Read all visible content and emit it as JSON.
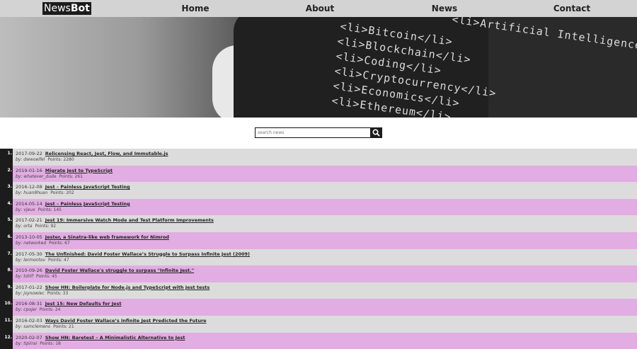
{
  "nav": {
    "logo_plain": "News",
    "logo_bold": "Bot",
    "links": [
      "Home",
      "About",
      "News",
      "Contact"
    ]
  },
  "hero": {
    "code_lines": [
      "<li>Bitcoin</li>",
      "<li>Blockchain</li>",
      "<li>Coding</li>",
      "<li>Cryptocurrency</li>",
      "<li>Economics</li>",
      "<li>Ethereum</li>",
      "<li>Artificial Intelligence</li>"
    ]
  },
  "search": {
    "placeholder": "search news",
    "icon": "search-icon"
  },
  "stories": [
    {
      "num": "1.",
      "date": "2017-09-22",
      "title": "Relicensing React, Jest, Flow, and Immutable.js",
      "author": "by: dwwoelfel",
      "points": "Points: 2280"
    },
    {
      "num": "2.",
      "date": "2019-01-16",
      "title": "Migrate Jest to TypeScript",
      "author": "by: whatever_dude",
      "points": "Points: 261"
    },
    {
      "num": "3.",
      "date": "2016-12-08",
      "title": "Jest – Painless JavaScript Testing",
      "author": "by: huan9huan",
      "points": "Points: 202"
    },
    {
      "num": "4.",
      "date": "2014-05-14",
      "title": "Jest – Painless JavaScript Testing",
      "author": "by: vjeux",
      "points": "Points: 145"
    },
    {
      "num": "5.",
      "date": "2017-02-21",
      "title": "Jest 19: Immersive Watch Mode and Test Platform Improvements",
      "author": "by: orta",
      "points": "Points: 92"
    },
    {
      "num": "6.",
      "date": "2013-10-05",
      "title": "Jester, a Sinatra-like web framework for Nimrod",
      "author": "by: networked",
      "points": "Points: 67"
    },
    {
      "num": "7.",
      "date": "2017-05-30",
      "title": "The Unfinished: David Foster Wallace’s Struggle to Surpass Infinite Jest (2009)",
      "author": "by: lermontov",
      "points": "Points: 47"
    },
    {
      "num": "8.",
      "date": "2010-09-26",
      "title": "David Foster Wallace's struggle to surpass \"Infinite Jest.\"",
      "author": "by: tshtf",
      "points": "Points: 45"
    },
    {
      "num": "9.",
      "date": "2017-01-22",
      "title": "Show HN: Boilerplate for Node.js and TypeScript with Jest tests",
      "author": "by: jsynowiec",
      "points": "Points: 33"
    },
    {
      "num": "10.",
      "date": "2016-08-31",
      "title": "Jest 15: New Defaults for Jest",
      "author": "by: cpojer",
      "points": "Points: 24"
    },
    {
      "num": "11.",
      "date": "2016-02-03",
      "title": "Ways David Foster Wallace’s Infinite Jest Predicted the Future",
      "author": "by: samclemens",
      "points": "Points: 21"
    },
    {
      "num": "12.",
      "date": "2020-02-07",
      "title": "Show HN: Baretest – A Minimalistic Alternative to Jest",
      "author": "by: tipiirai",
      "points": "Points: 18"
    }
  ],
  "colors": {
    "nav_bg": "#d3d3d3",
    "row_odd": "#dcdcdc",
    "row_even": "#e2ade2",
    "dark": "#1c1c1c"
  }
}
